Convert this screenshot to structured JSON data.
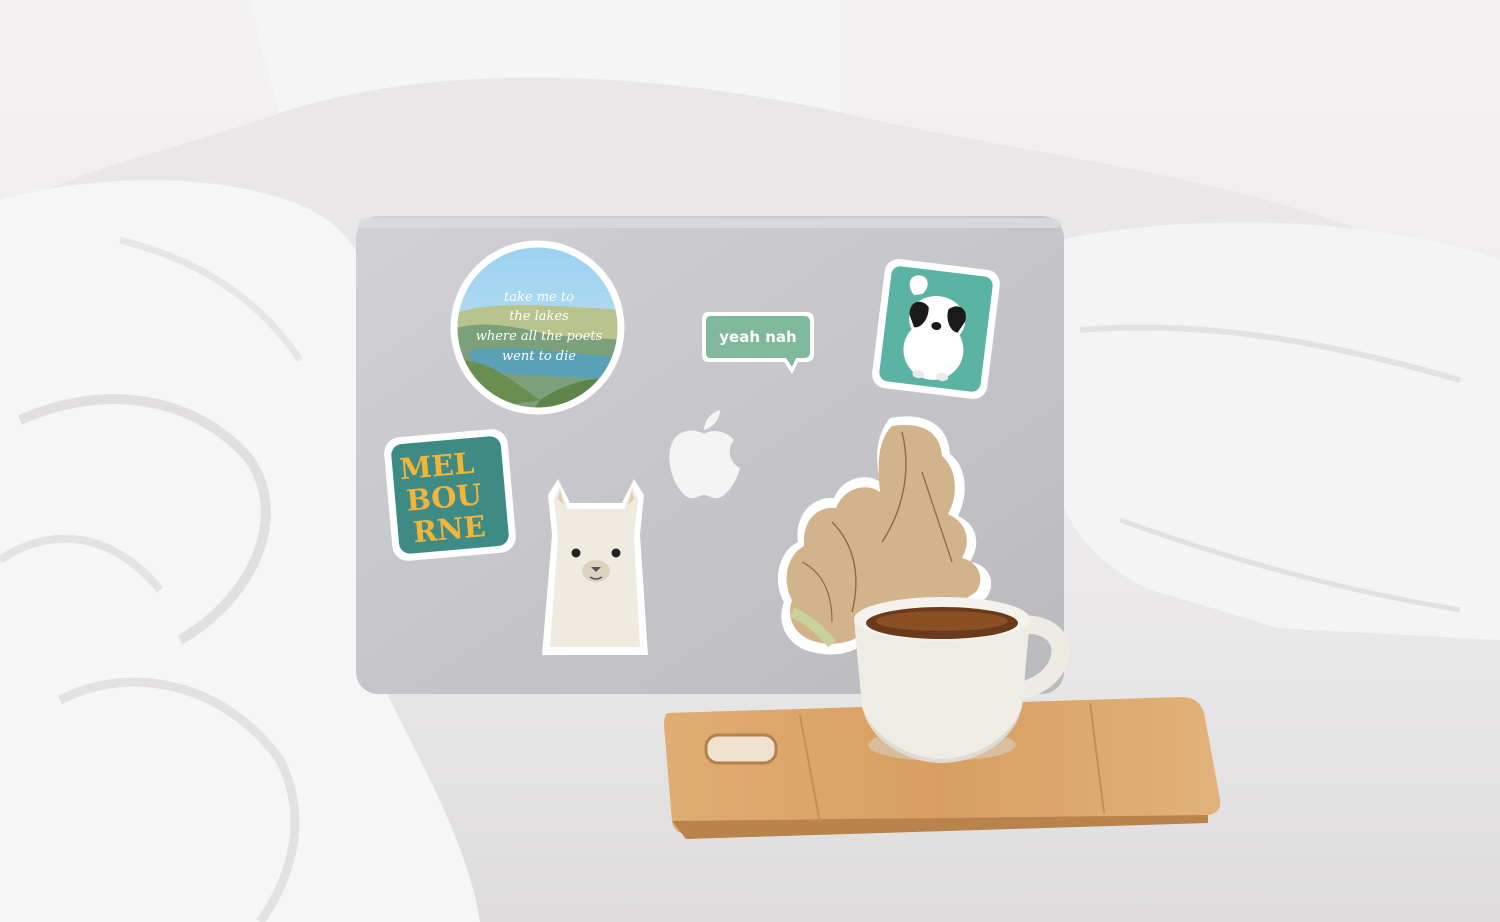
{
  "scene": {
    "colors": {
      "bedding": "#eceaea",
      "laptop_lid": "#c8c8cc",
      "apple_logo": "#f4f4f4",
      "board": "#d9a46a",
      "cup": "#efece6",
      "coffee": "#6b3a1a"
    }
  },
  "stickers": {
    "lakes": {
      "lines": [
        "take me to",
        "the lakes",
        "where all the poets",
        "went to die"
      ]
    },
    "speech": {
      "text": "yeah nah",
      "color": "#7fb89a"
    },
    "melbourne": {
      "lines": [
        "MEL",
        "BOU",
        "RNE"
      ],
      "bg_color": "#3e8b86",
      "text_color": "#f2b53a"
    },
    "dog": {
      "bg_color": "#5bb3a3"
    },
    "alpaca": {
      "color": "#efebe1"
    },
    "ginger": {
      "color": "#d2b48c"
    }
  }
}
